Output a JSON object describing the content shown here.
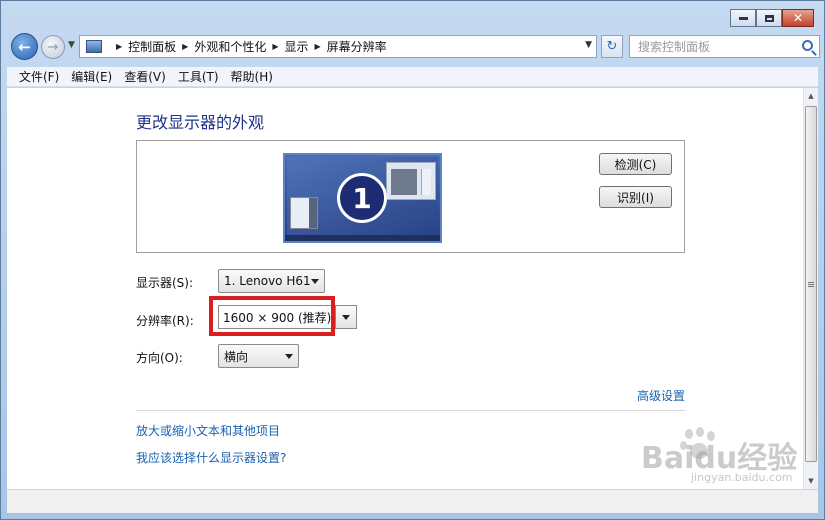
{
  "window": {
    "caption": {
      "close_glyph": "✕"
    }
  },
  "navigation": {
    "breadcrumbs": [
      "控制面板",
      "外观和个性化",
      "显示",
      "屏幕分辨率"
    ],
    "search_placeholder": "搜索控制面板"
  },
  "menu": {
    "items": [
      "文件(F)",
      "编辑(E)",
      "查看(V)",
      "工具(T)",
      "帮助(H)"
    ]
  },
  "main": {
    "title": "更改显示器的外观",
    "monitor_number": "1",
    "detect_label": "检测(C)",
    "identify_label": "识别(I)",
    "display_label": "显示器(S):",
    "display_value": "1. Lenovo H61",
    "resolution_label": "分辨率(R):",
    "resolution_value": "1600 × 900 (推荐)",
    "orientation_label": "方向(O):",
    "orientation_value": "横向",
    "advanced_link": "高级设置",
    "link_text_size": "放大或缩小文本和其他项目",
    "link_which_settings": "我应该选择什么显示器设置?"
  },
  "watermark": {
    "brand": "Baidu经验",
    "site": "jingyan.baidu.com"
  },
  "colors": {
    "title_blue": "#1e3287",
    "link_blue": "#1b61b0",
    "highlight_red": "#d81e1e"
  }
}
